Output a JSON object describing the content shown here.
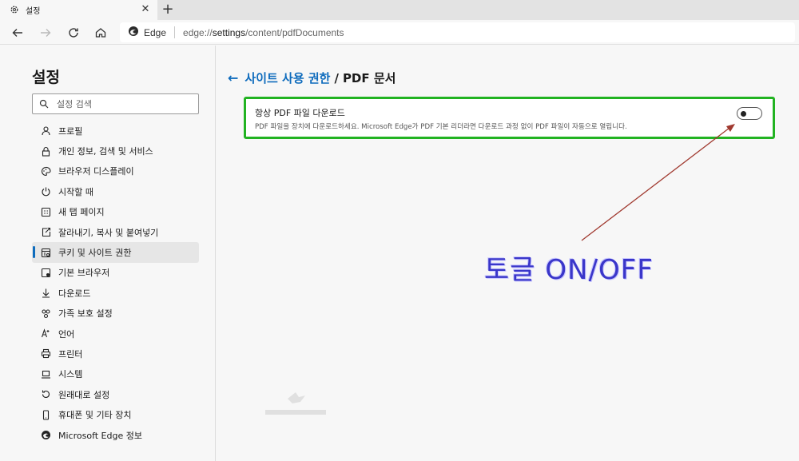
{
  "tab": {
    "title": "설정",
    "close_glyph": "✕",
    "new_tab_glyph": "+"
  },
  "address": {
    "browser_label": "Edge",
    "url_prefix": "edge://",
    "url_host": "settings",
    "url_path": "/content/pdfDocuments"
  },
  "sidebar": {
    "title": "설정",
    "search_placeholder": "설정 검색",
    "items": [
      {
        "label": "프로필",
        "icon": "profile-icon"
      },
      {
        "label": "개인 정보, 검색 및 서비스",
        "icon": "lock-icon"
      },
      {
        "label": "브라우저 디스플레이",
        "icon": "palette-icon"
      },
      {
        "label": "시작할 때",
        "icon": "power-icon"
      },
      {
        "label": "새 탭 페이지",
        "icon": "grid-icon"
      },
      {
        "label": "잘라내기, 복사 및 붙여넣기",
        "icon": "clipboard-icon"
      },
      {
        "label": "쿠키 및 사이트 권한",
        "icon": "cookie-icon",
        "active": true
      },
      {
        "label": "기본 브라우저",
        "icon": "browser-icon"
      },
      {
        "label": "다운로드",
        "icon": "download-icon"
      },
      {
        "label": "가족 보호 설정",
        "icon": "family-icon"
      },
      {
        "label": "언어",
        "icon": "language-icon"
      },
      {
        "label": "프린터",
        "icon": "printer-icon"
      },
      {
        "label": "시스템",
        "icon": "laptop-icon"
      },
      {
        "label": "원래대로 설정",
        "icon": "reset-icon"
      },
      {
        "label": "휴대폰 및 기타 장치",
        "icon": "phone-icon"
      },
      {
        "label": "Microsoft Edge 정보",
        "icon": "edge-icon"
      }
    ]
  },
  "main": {
    "back_glyph": "←",
    "breadcrumb_parent": "사이트 사용 권한",
    "breadcrumb_sep": "/",
    "breadcrumb_current": "PDF 문서",
    "setting": {
      "title": "항상 PDF 파일 다운로드",
      "description": "PDF 파일을 장치에 다운로드하세요. Microsoft Edge가 PDF 기본 리더라면 다운로드 과정 없이 PDF 파일이 자동으로 열립니다.",
      "toggle_on": false
    }
  },
  "annotation": {
    "text": "토글 ON/OFF",
    "color": "#3a36c9",
    "arrow_color": "#a0392f"
  },
  "colors": {
    "accent": "#0f6cbd",
    "highlight_border": "#22b322"
  }
}
